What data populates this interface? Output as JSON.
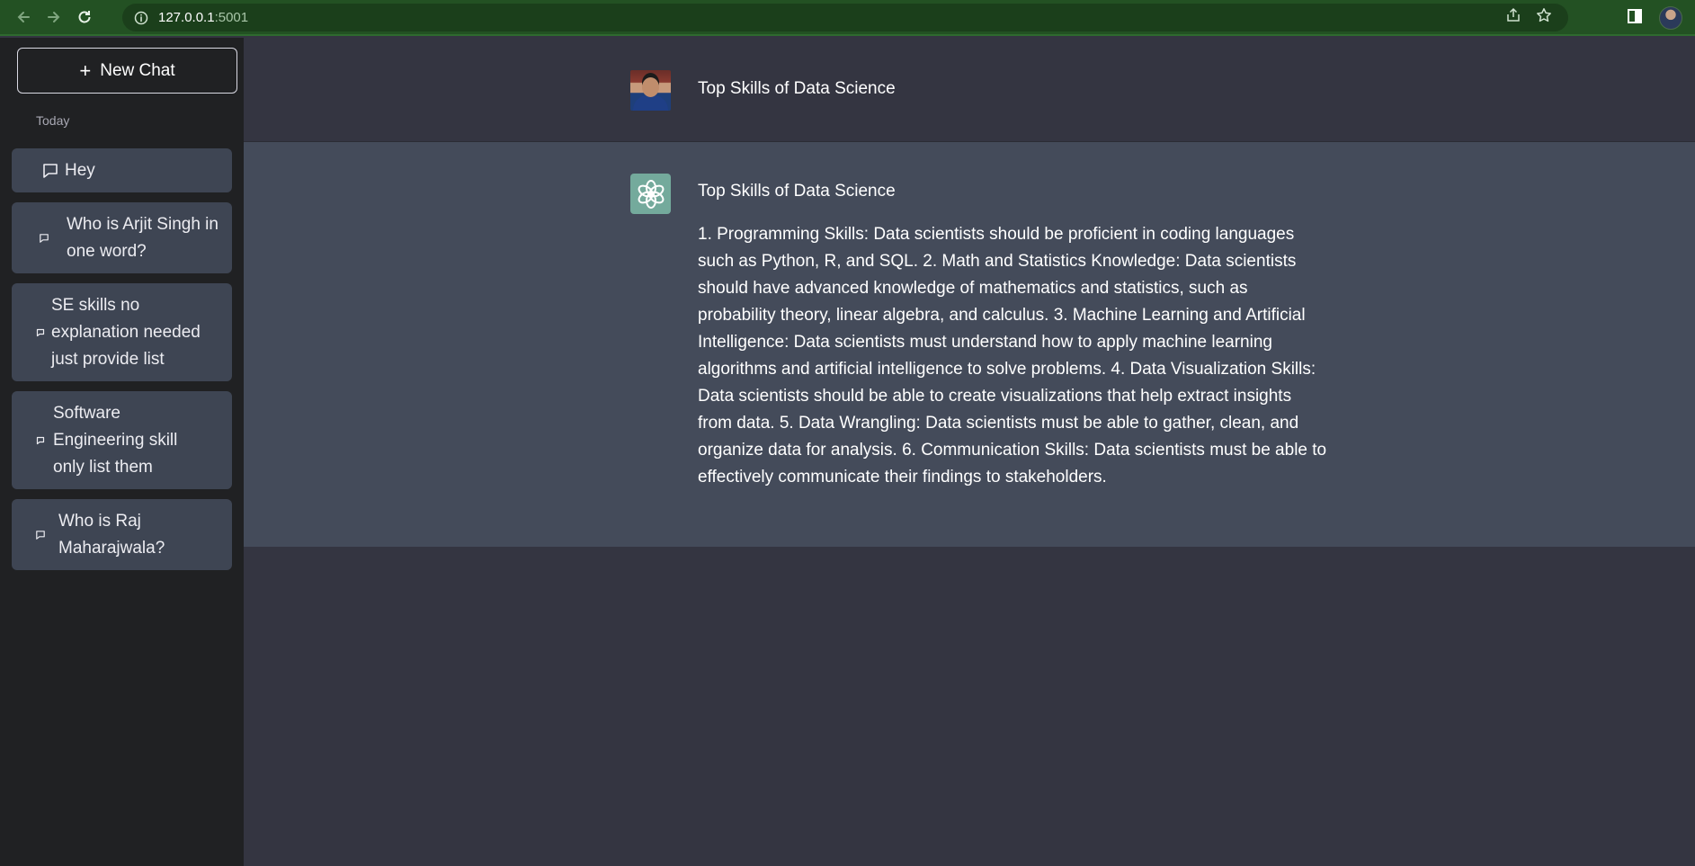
{
  "browser": {
    "url_host": "127.0.0.1",
    "url_port": ":5001"
  },
  "sidebar": {
    "new_chat_label": "New Chat",
    "section_label": "Today",
    "conversations": [
      {
        "label": "Hey"
      },
      {
        "label": "Who is Arjit Singh in one word?"
      },
      {
        "label": "SE skills no explanation needed just provide list"
      },
      {
        "label": "Software Engineering skill only list them"
      },
      {
        "label": "Who is Raj Maharajwala?"
      }
    ]
  },
  "chat": {
    "user_message": "Top Skills of Data Science",
    "bot_title": "Top Skills of Data Science",
    "bot_response": "1. Programming Skills: Data scientists should be proficient in coding languages such as Python, R, and SQL. 2. Math and Statistics Knowledge: Data scientists should have advanced knowledge of mathematics and statistics, such as probability theory, linear algebra, and calculus. 3. Machine Learning and Artificial Intelligence: Data scientists must understand how to apply machine learning algorithms and artificial intelligence to solve problems. 4. Data Visualization Skills: Data scientists should be able to create visualizations that help extract insights from data. 5. Data Wrangling: Data scientists must be able to gather, clean, and organize data for analysis. 6. Communication Skills: Data scientists must be able to effectively communicate their findings to stakeholders."
  },
  "colors": {
    "browser_bar": "#235123",
    "sidebar": "#202123",
    "conversation_item": "#3e4553",
    "main_bg": "#343541",
    "bot_row_bg": "#444b5a",
    "bot_avatar": "#74aa9c"
  },
  "icons": {
    "back": "arrow-left-icon",
    "forward": "arrow-right-icon",
    "reload": "reload-icon",
    "site_info": "info-icon",
    "share": "share-icon",
    "bookmark": "star-icon",
    "side_panel": "side-panel-icon",
    "conversation": "chat-bubble-icon",
    "new_chat": "plus-icon",
    "bot": "openai-logo-icon"
  }
}
